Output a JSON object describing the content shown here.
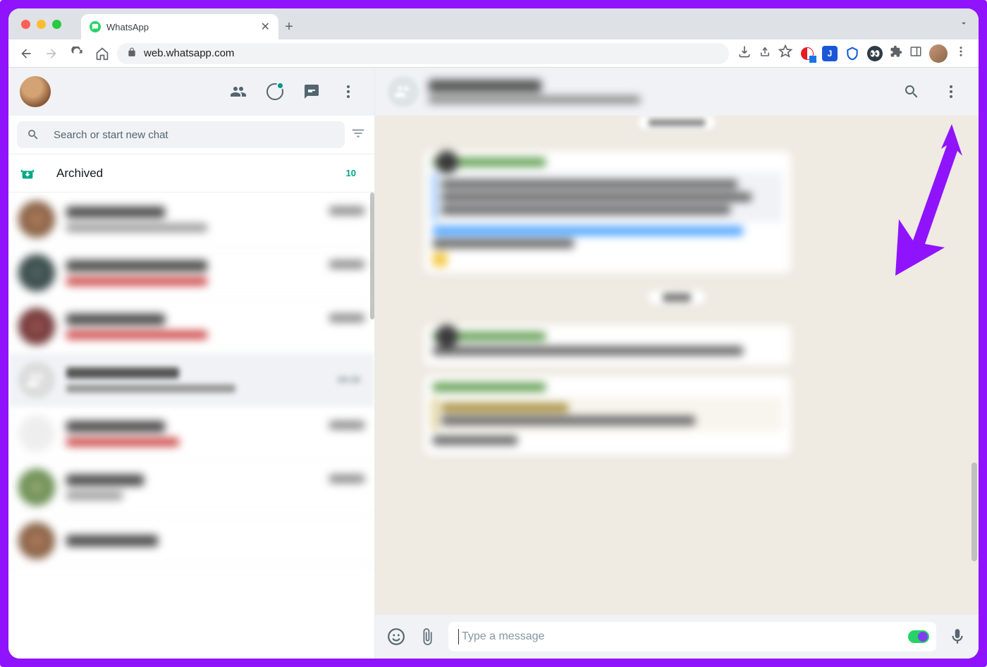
{
  "browser": {
    "tab_title": "WhatsApp",
    "url_display": "web.whatsapp.com",
    "new_tab_label": "+"
  },
  "sidebar": {
    "search_placeholder": "Search or start new chat",
    "archived_label": "Archived",
    "archived_count": "10",
    "selected_time": "08:08"
  },
  "composer": {
    "placeholder": "Type a message"
  },
  "colors": {
    "accent": "#00a884",
    "annotation": "#9013fe"
  }
}
